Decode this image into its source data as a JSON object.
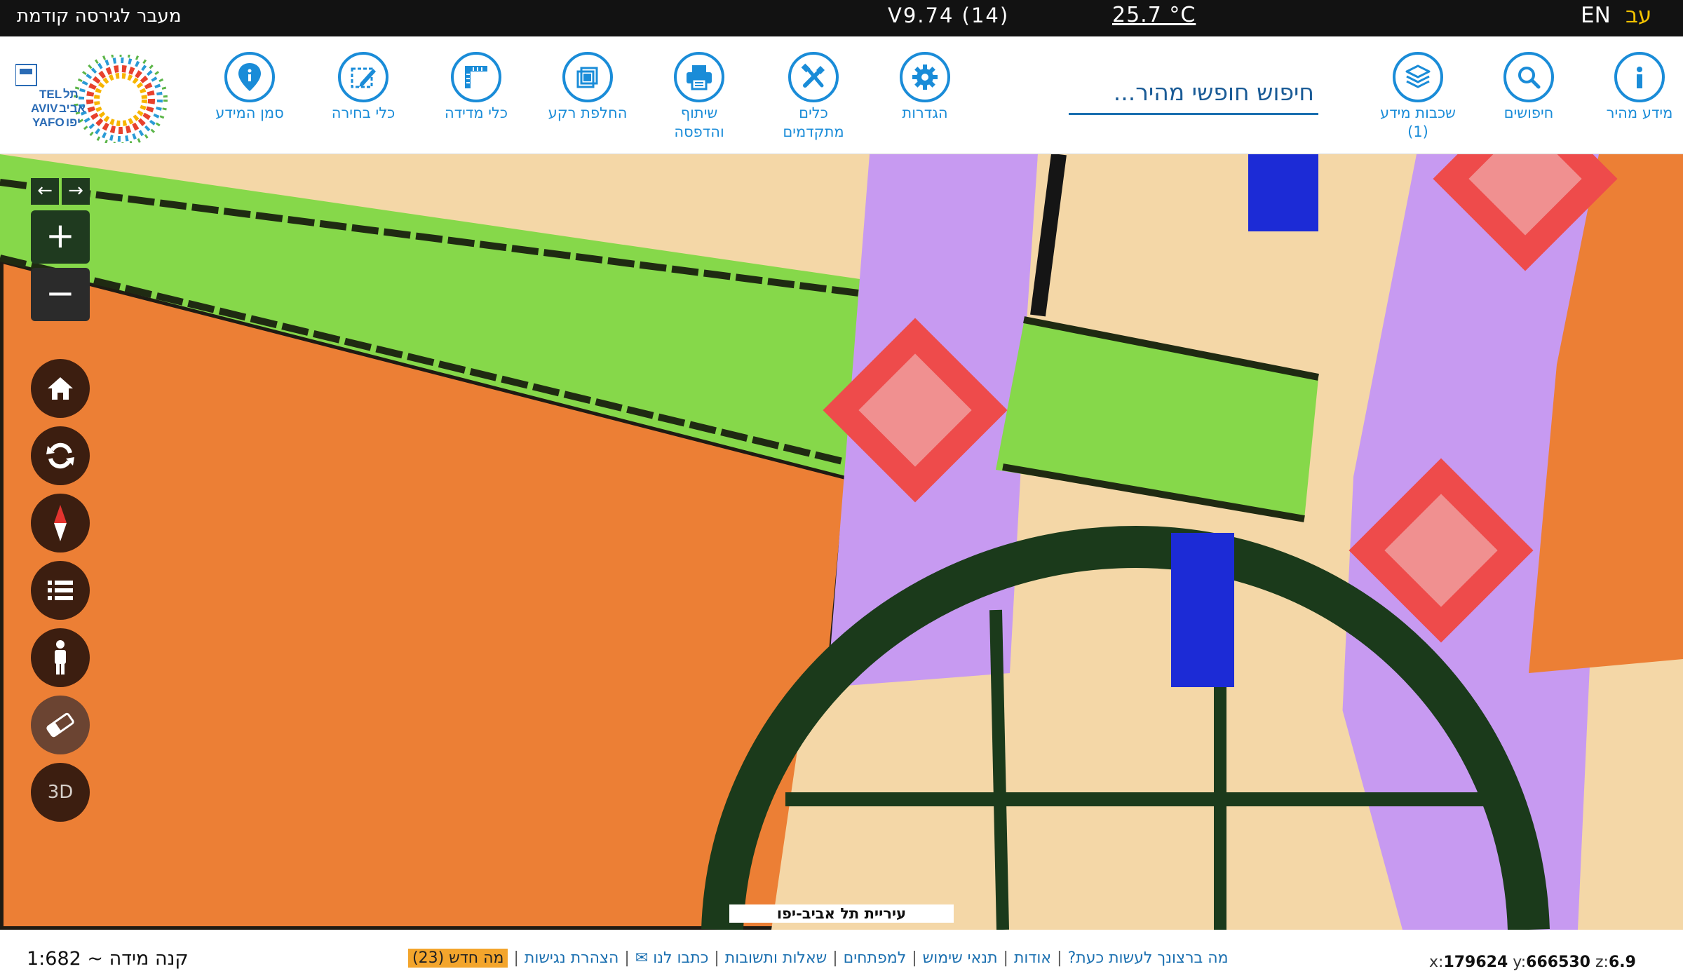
{
  "topbar": {
    "prev_version": "מעבר לגירסה קודמת",
    "version": "V9.74 (14)",
    "temperature": "25.7 °C",
    "lang_en": "EN",
    "lang_he": "עב"
  },
  "toolbar": {
    "logo_alt": "תל אביב יפו TEL AVIV YAFO",
    "search_placeholder": "חיפוש חופשי מהיר...",
    "tools": {
      "quick_info": "מידע מהיר",
      "searches": "חיפושים",
      "layers_line1": "שכבות מידע",
      "layers_line2": "(1)",
      "settings": "הגדרות",
      "advanced_line1": "כלים",
      "advanced_line2": "מתקדמים",
      "share_line1": "שיתוף",
      "share_line2": "והדפסה",
      "basemap": "החלפת רקע",
      "measure": "כלי מדידה",
      "select": "כלי בחירה",
      "marker": "סמן המידע"
    }
  },
  "map": {
    "city_label": "עיריית תל אביב-יפו",
    "pan_left": "←",
    "pan_right": "→",
    "zoom_in": "+",
    "zoom_out": "−",
    "btn_3d": "3D",
    "controls": [
      "home-icon",
      "refresh-icon",
      "compass-icon",
      "list-icon",
      "person-icon",
      "eraser-icon"
    ]
  },
  "bottom": {
    "scale": "קנה מידה ~ 1:682",
    "links": {
      "what_to_do": "מה ברצונך לעשות כעת?",
      "about": "אודות",
      "terms": "תנאי שימוש",
      "developers": "למפתחים",
      "faq": "שאלות ותשובות",
      "contact": "כתבו לנו ✉",
      "accessibility": "הצהרת נגישות",
      "whats_new": "מה חדש (23)"
    },
    "coords": {
      "x_label": "x:",
      "x": "179624",
      "y_label": "y:",
      "y": "666530",
      "z_label": "z:",
      "z": "6.9"
    }
  },
  "colors": {
    "accent": "#1a8cd8",
    "topbar": "#121212",
    "map_orange": "#ec7f35",
    "map_green": "#86d84a",
    "map_purple": "#c79af1",
    "map_beige": "#f4d7a7",
    "map_dark_green": "#1b3a1b",
    "map_blue": "#1c2bd6",
    "map_red": "#ee4b4b",
    "badge": "#f3a52c"
  }
}
